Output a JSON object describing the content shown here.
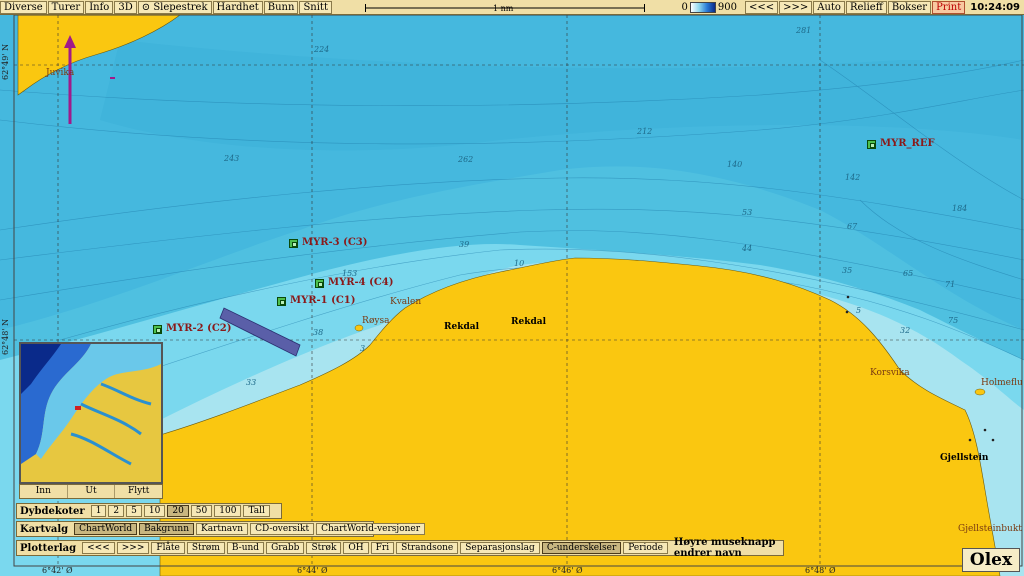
{
  "toolbar": {
    "left_buttons": [
      "Diverse",
      "Turer",
      "Info",
      "3D"
    ],
    "slepestrek_label": "Slepestrek",
    "mid_buttons": [
      "Hardhet",
      "Bunn",
      "Snitt"
    ],
    "scale_label": "1 nm",
    "depth_min": "0",
    "depth_max": "900",
    "right_buttons": [
      "<<<",
      ">>>",
      "Auto",
      "Relieff",
      "Bokser"
    ],
    "print_label": "Print",
    "clock": "10:24:09"
  },
  "axis": {
    "lat_upper": "62°49' N",
    "lat_lower": "62°48' N",
    "lon_labels": [
      "6°42' Ø",
      "6°44' Ø",
      "6°46' Ø",
      "6°48' Ø"
    ]
  },
  "stations": [
    {
      "label": "MYR_REF"
    },
    {
      "label": "MYR-3 (C3)"
    },
    {
      "label": "MYR-4 (C4)"
    },
    {
      "label": "MYR-1 (C1)"
    },
    {
      "label": "MYR-2 (C2)"
    }
  ],
  "places": {
    "juvika": "Juvika",
    "kvalen": "Kvalen",
    "roysa": "Røysa",
    "rekdal1": "Rekdal",
    "rekdal2": "Rekdal",
    "korsvika": "Korsvika",
    "holmeflu": "Holmeflu",
    "gjellstein": "Gjellstein",
    "gjellsteinbukt": "Gjellsteinbukt"
  },
  "depth_labels": [
    "224",
    "281",
    "243",
    "262",
    "212",
    "140",
    "142",
    "184",
    "39",
    "153",
    "53",
    "44",
    "67",
    "35",
    "65",
    "71",
    "75",
    "32",
    "38",
    "33",
    "10",
    "5",
    "3"
  ],
  "minimap": {
    "buttons": [
      "Inn",
      "Ut",
      "Flytt"
    ]
  },
  "dybdekoter": {
    "label": "Dybdekoter",
    "options": [
      "1",
      "2",
      "5",
      "10",
      "20",
      "50",
      "100",
      "Tall"
    ],
    "selected": "20"
  },
  "kartvalg": {
    "label": "Kartvalg",
    "buttons": [
      "ChartWorld",
      "Bakgrunn",
      "Kartnavn",
      "CD-oversikt",
      "ChartWorld-versjoner"
    ],
    "selected": [
      "ChartWorld",
      "Bakgrunn"
    ]
  },
  "plotterlag": {
    "label": "Plotterlag",
    "buttons": [
      "<<<",
      ">>>",
      "Flåte",
      "Strøm",
      "B-und",
      "Grabb",
      "Strøk",
      "OH",
      "Fri",
      "Strandsone",
      "Separasjonslag",
      "C-underskelser",
      "Periode"
    ],
    "selected": "C-underskelser",
    "hint": "Høyre museknapp endrer navn"
  },
  "brand": "Olex",
  "colors": {
    "land": "#fac710",
    "shallow": "#a8e4f0",
    "mid": "#5ecbe6",
    "deep": "#3fb4da",
    "toolbar": "#f0dfa6",
    "station": "#4ec04e",
    "transect": "#5a5fa8",
    "arrow": "#a01a8a"
  }
}
